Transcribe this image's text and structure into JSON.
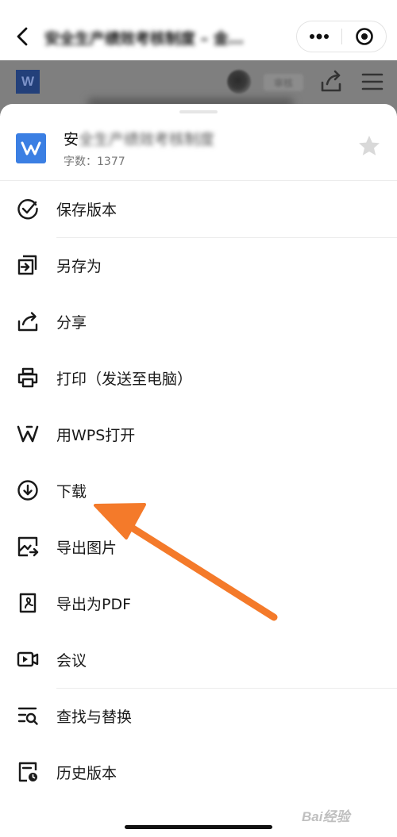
{
  "topbar": {
    "title": "安全生产绩效考核制度 – 金…",
    "more_glyph": "•••"
  },
  "doc_toolbar": {
    "logo_letter": "W",
    "collab_label": "审核"
  },
  "file": {
    "name_first": "安",
    "name_rest": "全生产绩效考核制度",
    "word_count": "字数：1377"
  },
  "menu": {
    "items": [
      {
        "label": "保存版本",
        "icon": "check-circle-icon"
      },
      {
        "label": "另存为",
        "icon": "save-as-icon"
      },
      {
        "label": "分享",
        "icon": "share-icon"
      },
      {
        "label": "打印（发送至电脑）",
        "icon": "printer-icon"
      },
      {
        "label": "用WPS打开",
        "icon": "wps-icon"
      },
      {
        "label": "下载",
        "icon": "download-icon"
      },
      {
        "label": "导出图片",
        "icon": "export-image-icon"
      },
      {
        "label": "导出为PDF",
        "icon": "export-pdf-icon"
      },
      {
        "label": "会议",
        "icon": "meeting-icon"
      },
      {
        "label": "查找与替换",
        "icon": "find-replace-icon"
      },
      {
        "label": "历史版本",
        "icon": "history-icon"
      }
    ]
  },
  "watermark": "Bai经验",
  "colors": {
    "accent_blue": "#3b7fe3",
    "annotation_orange": "#f47a2a",
    "dim_overlay": "#7f7f7f"
  }
}
